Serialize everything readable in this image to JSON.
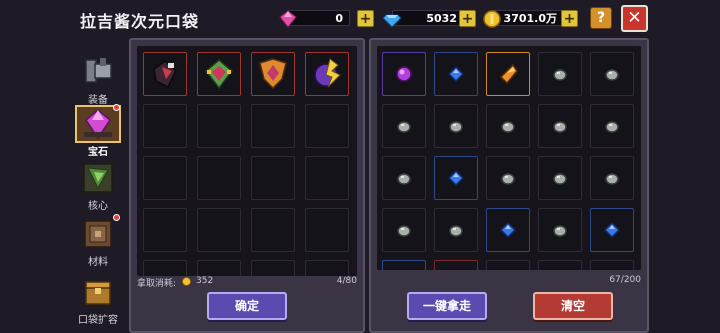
{
  "header": {
    "title": "拉吉酱次元口袋",
    "currencies": [
      {
        "icon": "pink-gem-icon",
        "value": "0"
      },
      {
        "icon": "blue-diamond-icon",
        "value": "5032"
      },
      {
        "icon": "gold-coin-icon",
        "value": "3701.0万"
      }
    ],
    "help_label": "?",
    "close_label": "✕"
  },
  "sidebar": {
    "items": [
      {
        "label": "装备",
        "icon": "equipment-icon",
        "active": false,
        "badge": false
      },
      {
        "label": "宝石",
        "icon": "gem-icon",
        "active": true,
        "badge": true
      },
      {
        "label": "核心",
        "icon": "core-icon",
        "active": false,
        "badge": false
      },
      {
        "label": "材料",
        "icon": "material-icon",
        "active": false,
        "badge": true
      },
      {
        "label": "口袋扩容",
        "icon": "pocket-expand-icon",
        "active": false,
        "badge": false
      }
    ]
  },
  "left_panel": {
    "capacity": "4/80",
    "cost_label": "拿取消耗:",
    "cost_value": "352",
    "confirm_label": "确定",
    "items": [
      "dark-ruby-gem",
      "green-red-gem",
      "orange-crest-gem",
      "purple-lightning-gem"
    ]
  },
  "right_panel": {
    "capacity": "67/200",
    "take_all_label": "一键拿走",
    "clear_label": "清空",
    "rows": [
      [
        "purple-orb",
        "blue-gem",
        "orange-gem",
        "gray-stone",
        "gray-stone"
      ],
      [
        "gray-stone",
        "gray-stone",
        "gray-stone",
        "gray-stone",
        "gray-stone"
      ],
      [
        "gray-stone",
        "blue-gem",
        "gray-stone",
        "gray-stone",
        "gray-stone"
      ],
      [
        "gray-stone",
        "gray-stone",
        "blue-gem",
        "gray-stone",
        "blue-gem"
      ]
    ]
  },
  "colors": {
    "accent_purple": "#5b4bb0",
    "accent_red": "#b43a34",
    "gold": "#e2c53b"
  }
}
